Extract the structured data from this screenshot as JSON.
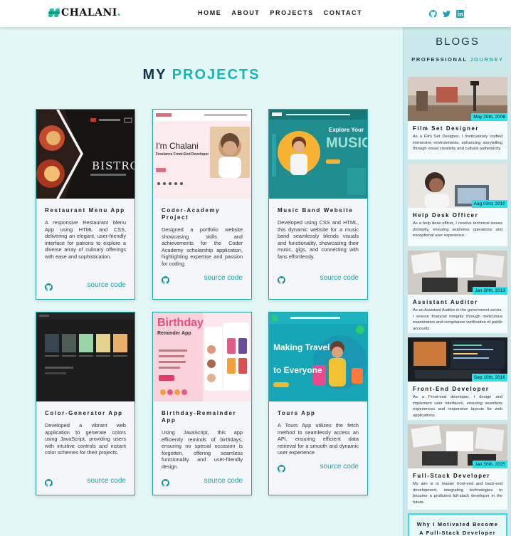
{
  "brand": {
    "name_part1": "CHALANI",
    "name_part2": "."
  },
  "nav": [
    "HOME",
    "ABOUT",
    "PROJECTS",
    "CONTACT"
  ],
  "social": [
    "github-icon",
    "twitter-icon",
    "linkedin-icon"
  ],
  "projects_section": {
    "heading_part1": "MY",
    "heading_part2": "PROJECTS"
  },
  "projects": [
    {
      "title": "Restaurant Menu App",
      "description": "A responsive Restaurant Menu App using HTML and CSS, delivering an elegant, user-friendly interface for patrons to explore a diverse array of culinary offerings with ease and sophistication.",
      "link": "source code",
      "thumb_text": "BISTRO"
    },
    {
      "title": "Coder-Academy Project",
      "description": "Designed a portfolio website showcasing skills and achievements for the Coder Academy scholarship application, highlighting expertise and passion for coding.",
      "link": "source code",
      "thumb_text": "I'm Chalani",
      "thumb_sub": "Freelance Front-End Developer"
    },
    {
      "title": "Music Band Website",
      "description": "Developed using CSS and HTML, this dynamic website for a music band seamlessly blends visuals and functionality, showcasing their music, gigs, and connecting with fans effortlessly.",
      "link": "source code",
      "thumb_text": "MUSIC",
      "thumb_sub": "Explore Your"
    },
    {
      "title": "Color-Generator App",
      "description": "Developed a vibrant web application to generate colors using JavaScript, providing users with intuitive controls and instant color schemes for their projects.",
      "link": "source code"
    },
    {
      "title": "Birthday-Remainder App",
      "description": "Using JavaScript, this app efficiently reminds of birthdays, ensuring no special occasion is forgotten, offering seamless functionality and user-friendly design.",
      "link": "source code",
      "thumb_text": "Birthday",
      "thumb_sub": "Reminder App"
    },
    {
      "title": "Tours App",
      "description": "A Tours App utilizes the fetch method to seamlessly access an API, ensuring efficient data retrieval for a smooth and dynamic user experience",
      "link": "source code",
      "thumb_text": "Making Travel",
      "thumb_sub": "to Everyone"
    }
  ],
  "blogs": {
    "title": "BLOGS",
    "subtitle_part1": "PROFESSIONAL",
    "subtitle_part2": "JOURNEY",
    "posts": [
      {
        "date": "May 20th, 2008",
        "title": "Film Set Designer",
        "description": "As a Film Set Designer, I meticulously crafted immersive environments, enhancing storytelling through visual creativity and cultural authenticity."
      },
      {
        "date": "Aug 03rd, 2010",
        "title": "Help Desk Officer",
        "description": "As a help desk officer, I resolve technical issues promptly, ensuring seamless operations and exceptional user experience."
      },
      {
        "date": "Jan 30th, 2013",
        "title": "Assistant Auditor",
        "description": "As an Assistant Auditor in the government sector, I ensure financial integrity through meticulous examination and compliance verification of public accounts."
      },
      {
        "date": "Sep 10th, 2016",
        "title": "Front-End Developer",
        "description": "As a Front-end developer, I design and implement user interfaces, ensuring seamless experiences and responsive layouts for web applications."
      },
      {
        "date": "Jan 30th, 2025",
        "title": "Full-Stack Developer",
        "description": "My aim is to master front-end and back-end development, integrating technologies to become a proficient full-stack developer in the future."
      }
    ],
    "last_card": [
      "Why I Motivated Become",
      "A Full-Stack Developer"
    ]
  }
}
